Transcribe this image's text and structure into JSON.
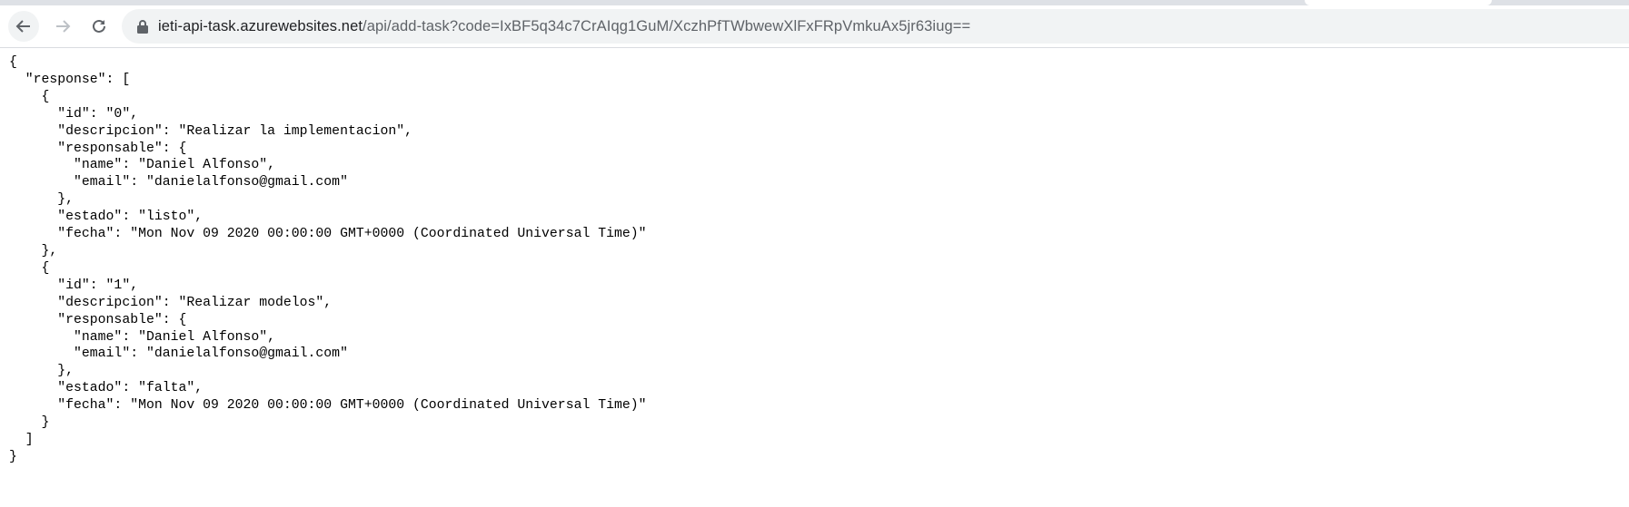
{
  "browser": {
    "url_host": "ieti-api-task.azurewebsites.net",
    "url_rest": "/api/add-task?code=IxBF5q34c7CrAIqg1GuM/XczhPfTWbwewXlFxFRpVmkuAx5jr63iug==",
    "icons": [
      "back-arrow-icon",
      "forward-arrow-icon",
      "reload-icon",
      "lock-icon"
    ]
  },
  "json_lines": [
    "{",
    "  \"response\": [",
    "    {",
    "      \"id\": \"0\",",
    "      \"descripcion\": \"Realizar la implementacion\",",
    "      \"responsable\": {",
    "        \"name\": \"Daniel Alfonso\",",
    "        \"email\": \"danielalfonso@gmail.com\"",
    "      },",
    "      \"estado\": \"listo\",",
    "      \"fecha\": \"Mon Nov 09 2020 00:00:00 GMT+0000 (Coordinated Universal Time)\"",
    "    },",
    "    {",
    "      \"id\": \"1\",",
    "      \"descripcion\": \"Realizar modelos\",",
    "      \"responsable\": {",
    "        \"name\": \"Daniel Alfonso\",",
    "        \"email\": \"danielalfonso@gmail.com\"",
    "      },",
    "      \"estado\": \"falta\",",
    "      \"fecha\": \"Mon Nov 09 2020 00:00:00 GMT+0000 (Coordinated Universal Time)\"",
    "    }",
    "  ]",
    "}"
  ]
}
